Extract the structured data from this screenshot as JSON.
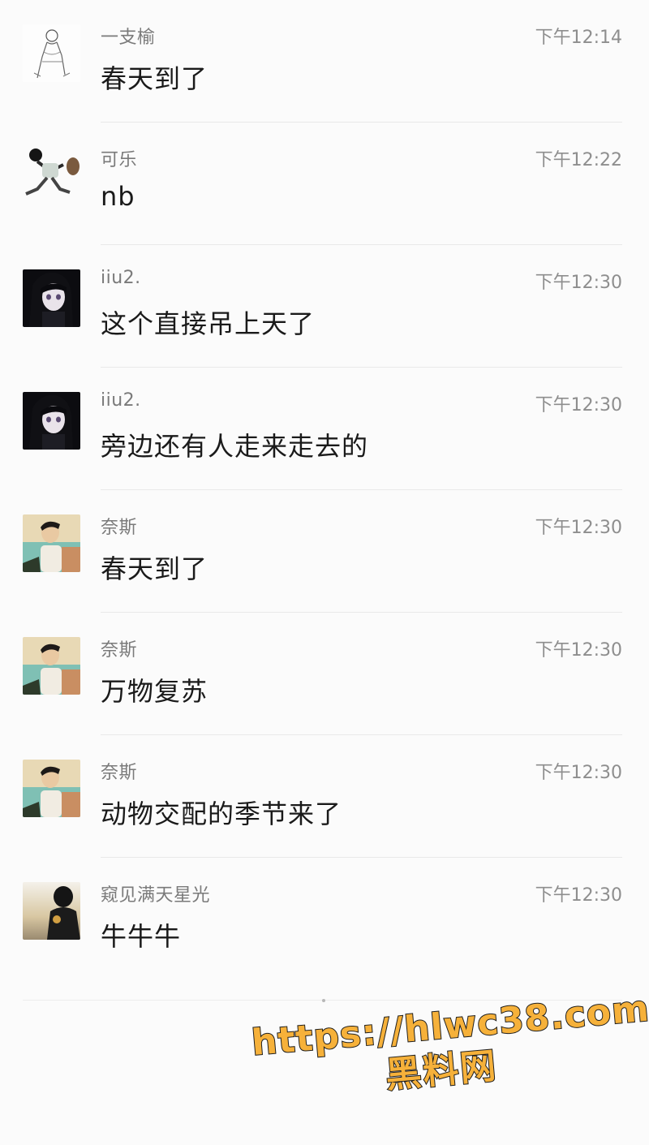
{
  "comments": [
    {
      "name": "一支榆",
      "time": "下午12:14",
      "text": "春天到了",
      "avatar": "sketch-avatar"
    },
    {
      "name": "可乐",
      "time": "下午12:22",
      "text": "nb",
      "avatar": "running-kid-avatar"
    },
    {
      "name": "iiu2.",
      "time": "下午12:30",
      "text": "这个直接吊上天了",
      "avatar": "anime-girl-avatar"
    },
    {
      "name": "iiu2.",
      "time": "下午12:30",
      "text": "旁边还有人走来走去的",
      "avatar": "anime-girl-avatar"
    },
    {
      "name": "奈斯",
      "time": "下午12:30",
      "text": "春天到了",
      "avatar": "cartoon-man-avatar"
    },
    {
      "name": "奈斯",
      "time": "下午12:30",
      "text": "万物复苏",
      "avatar": "cartoon-man-avatar"
    },
    {
      "name": "奈斯",
      "time": "下午12:30",
      "text": "动物交配的季节来了",
      "avatar": "cartoon-man-avatar"
    },
    {
      "name": "窥见满天星光",
      "time": "下午12:30",
      "text": "牛牛牛",
      "avatar": "silhouette-avatar"
    }
  ],
  "watermark": {
    "url": "https://hlwc38.com",
    "label": "黑料网"
  },
  "colors": {
    "background": "#fbfbfb",
    "name": "#7a7a7a",
    "time": "#8e8e8e",
    "text": "#1a1a1a",
    "watermark_fill": "#f6b13a"
  }
}
